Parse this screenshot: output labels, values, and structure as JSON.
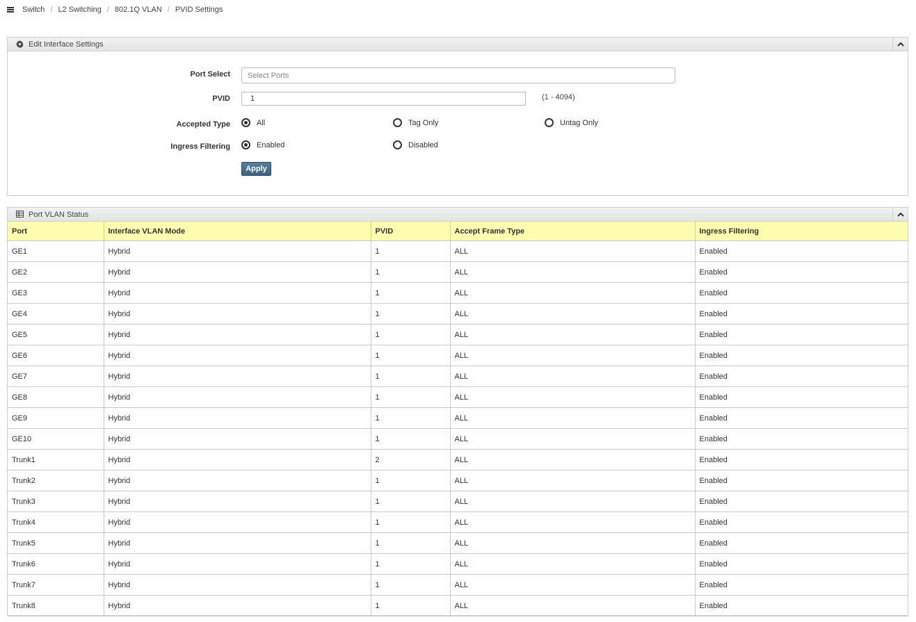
{
  "breadcrumb": [
    "Switch",
    "L2 Switching",
    "802.1Q VLAN",
    "PVID Settings"
  ],
  "edit_panel": {
    "title": "Edit Interface Settings",
    "port_select_label": "Port Select",
    "port_select_placeholder": "Select Ports",
    "pvid_label": "PVID",
    "pvid_value": "1",
    "pvid_range": "(1 - 4094)",
    "accepted_type_label": "Accepted Type",
    "accepted_type_options": [
      "All",
      "Tag Only",
      "Untag Only"
    ],
    "accepted_type_selected": "All",
    "ingress_filtering_label": "Ingress Filtering",
    "ingress_options": [
      "Enabled",
      "Disabled"
    ],
    "ingress_selected": "Enabled",
    "apply_label": "Apply"
  },
  "status_panel": {
    "title": "Port VLAN Status",
    "columns": [
      "Port",
      "Interface VLAN Mode",
      "PVID",
      "Accept Frame Type",
      "Ingress Filtering"
    ],
    "rows": [
      [
        "GE1",
        "Hybrid",
        "1",
        "ALL",
        "Enabled"
      ],
      [
        "GE2",
        "Hybrid",
        "1",
        "ALL",
        "Enabled"
      ],
      [
        "GE3",
        "Hybrid",
        "1",
        "ALL",
        "Enabled"
      ],
      [
        "GE4",
        "Hybrid",
        "1",
        "ALL",
        "Enabled"
      ],
      [
        "GE5",
        "Hybrid",
        "1",
        "ALL",
        "Enabled"
      ],
      [
        "GE6",
        "Hybrid",
        "1",
        "ALL",
        "Enabled"
      ],
      [
        "GE7",
        "Hybrid",
        "1",
        "ALL",
        "Enabled"
      ],
      [
        "GE8",
        "Hybrid",
        "1",
        "ALL",
        "Enabled"
      ],
      [
        "GE9",
        "Hybrid",
        "1",
        "ALL",
        "Enabled"
      ],
      [
        "GE10",
        "Hybrid",
        "1",
        "ALL",
        "Enabled"
      ],
      [
        "Trunk1",
        "Hybrid",
        "2",
        "ALL",
        "Enabled"
      ],
      [
        "Trunk2",
        "Hybrid",
        "1",
        "ALL",
        "Enabled"
      ],
      [
        "Trunk3",
        "Hybrid",
        "1",
        "ALL",
        "Enabled"
      ],
      [
        "Trunk4",
        "Hybrid",
        "1",
        "ALL",
        "Enabled"
      ],
      [
        "Trunk5",
        "Hybrid",
        "1",
        "ALL",
        "Enabled"
      ],
      [
        "Trunk6",
        "Hybrid",
        "1",
        "ALL",
        "Enabled"
      ],
      [
        "Trunk7",
        "Hybrid",
        "1",
        "ALL",
        "Enabled"
      ],
      [
        "Trunk8",
        "Hybrid",
        "1",
        "ALL",
        "Enabled"
      ]
    ]
  },
  "icons": {
    "menu": "hamburger-menu-icon",
    "settings": "gear-icon",
    "table": "table-icon",
    "collapse": "chevron-up-icon"
  },
  "colors": {
    "header_row_bg": "#fdfdb0",
    "apply_button_bg": "#3c6281",
    "panel_header_bg": "#e8e8e8"
  }
}
